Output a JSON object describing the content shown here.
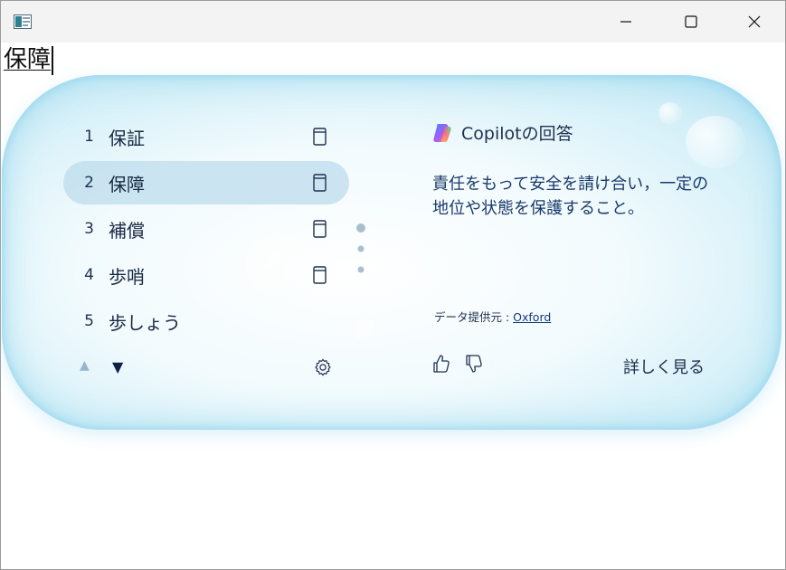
{
  "editor": {
    "composing_text": "保障"
  },
  "ime": {
    "candidates": [
      {
        "num": "1",
        "text": "保証"
      },
      {
        "num": "2",
        "text": "保障"
      },
      {
        "num": "3",
        "text": "補償"
      },
      {
        "num": "4",
        "text": "歩哨"
      },
      {
        "num": "5",
        "text": "歩しょう"
      }
    ],
    "selected_index": 1,
    "nav_up": "▲",
    "nav_down": "▼",
    "copilot": {
      "title": "Copilotの回答",
      "definition": "責任をもって安全を請け合い，一定の地位や状態を保護すること。",
      "source_label": "データ提供元 : ",
      "source_link": "Oxford",
      "more_label": "詳しく見る"
    }
  },
  "icons": {
    "app": "notepad-icon",
    "minimize": "minimize-icon",
    "maximize": "maximize-icon",
    "close": "close-icon",
    "dictionary": "dictionary-icon",
    "settings": "gear-icon",
    "thumbs_up": "thumbs-up-icon",
    "thumbs_down": "thumbs-down-icon",
    "copilot": "copilot-logo-icon"
  },
  "colors": {
    "titlebar": "#f3f3f3",
    "panel_edge": "#b0e1f2",
    "selected_row": "#bedcec",
    "text_dark": "#1a2a44",
    "definition_text": "#1a3a6a"
  }
}
